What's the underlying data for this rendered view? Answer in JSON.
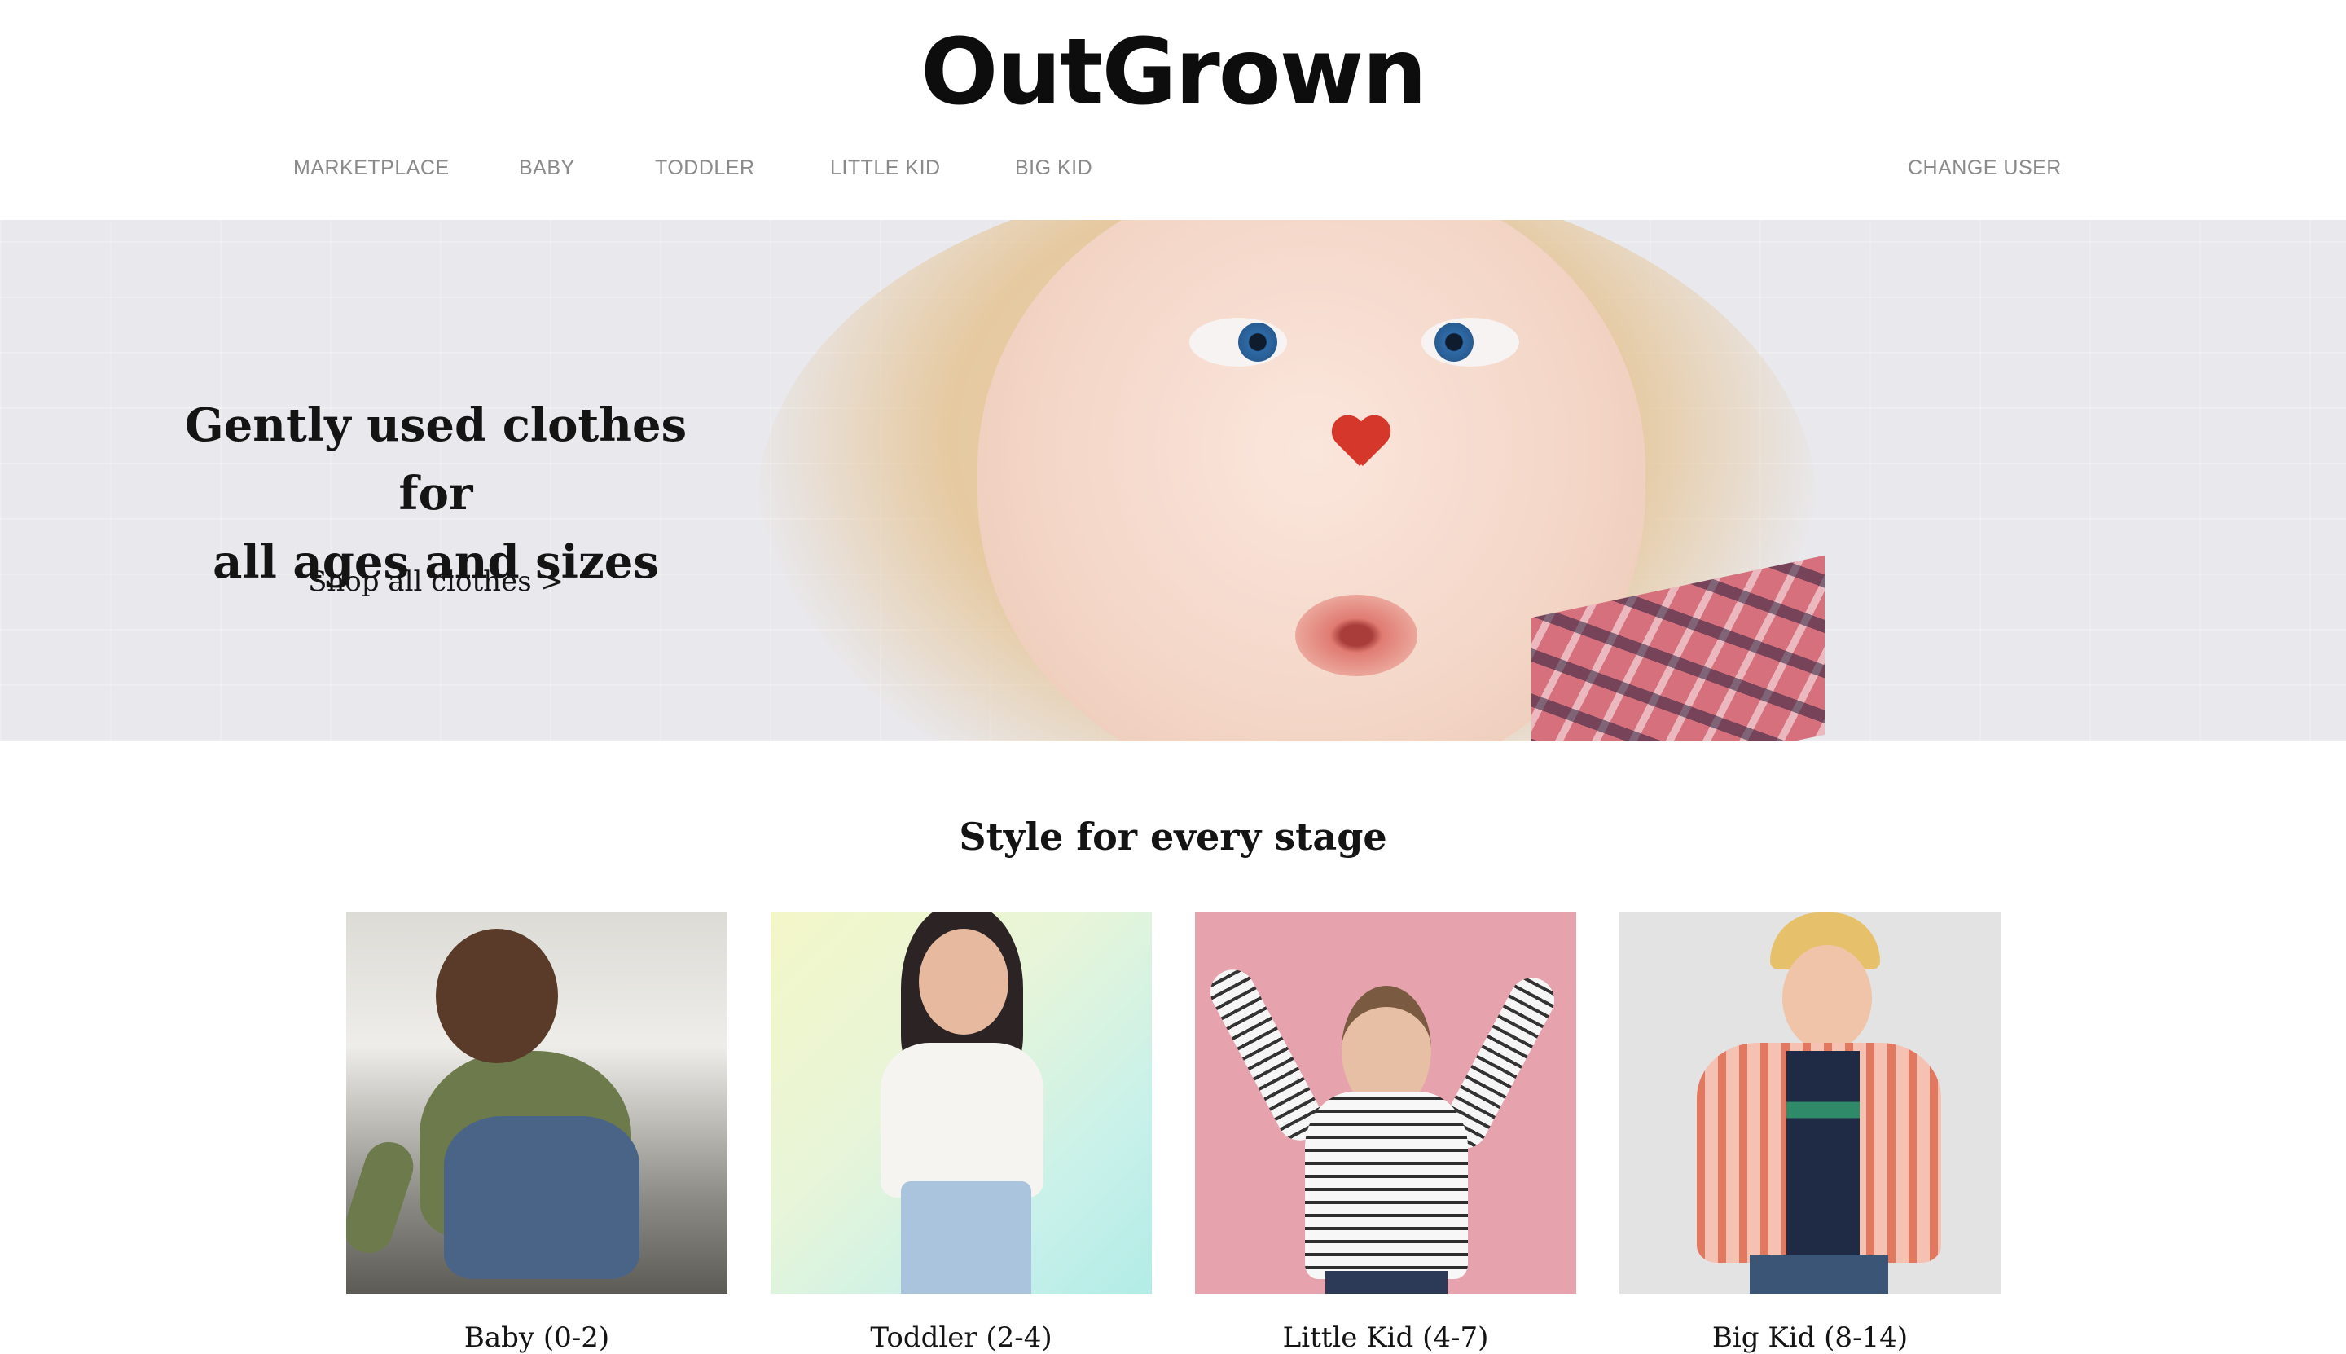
{
  "brand": {
    "logo": "OutGrown"
  },
  "nav": {
    "items": [
      {
        "label": "MARKETPLACE"
      },
      {
        "label": "BABY"
      },
      {
        "label": "TODDLER"
      },
      {
        "label": "LITTLE KID"
      },
      {
        "label": "BIG KID"
      }
    ],
    "change_user": "CHANGE USER"
  },
  "hero": {
    "title_line1": "Gently used clothes for",
    "title_line2": "all ages and sizes",
    "link": "Shop all clothes >"
  },
  "section": {
    "title": "Style for every stage",
    "cards": [
      {
        "label": "Baby (0-2)"
      },
      {
        "label": "Toddler (2-4)"
      },
      {
        "label": "Little Kid (4-7)"
      },
      {
        "label": "Big Kid (8-14)"
      }
    ]
  },
  "colors": {
    "text": "#141414",
    "nav": "#8a8a8a",
    "background": "#ffffff"
  }
}
